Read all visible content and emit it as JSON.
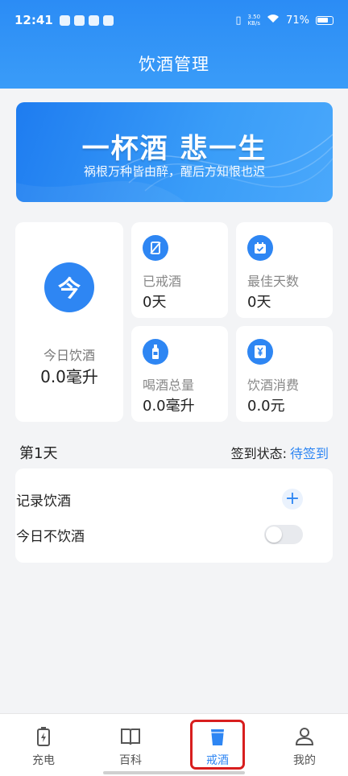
{
  "status_bar": {
    "time": "12:41",
    "net_speed_value": "3.50",
    "net_speed_unit": "KB/s",
    "battery": "71%"
  },
  "header": {
    "title": "饮酒管理"
  },
  "banner": {
    "title": "一杯酒 悲一生",
    "subtitle": "祸根万种皆由醉，醒后方知恨也迟"
  },
  "today": {
    "icon_char": "今",
    "label": "今日饮酒",
    "value": "0.0毫升"
  },
  "stats": [
    {
      "label": "已戒酒",
      "value": "0天",
      "icon": "no-drink-icon"
    },
    {
      "label": "最佳天数",
      "value": "0天",
      "icon": "calendar-check-icon"
    },
    {
      "label": "喝酒总量",
      "value": "0.0毫升",
      "icon": "bottle-icon"
    },
    {
      "label": "饮酒消费",
      "value": "0.0元",
      "icon": "yen-icon"
    }
  ],
  "day": {
    "label": "第1天",
    "checkin_label": "签到状态:",
    "checkin_state": "待签到"
  },
  "actions": {
    "record_label": "记录饮酒",
    "add_symbol": "+",
    "no_drink_label": "今日不饮酒",
    "no_drink_enabled": false
  },
  "tabbar": {
    "items": [
      {
        "label": "充电",
        "icon": "battery-charge-icon",
        "active": false
      },
      {
        "label": "百科",
        "icon": "book-icon",
        "active": false
      },
      {
        "label": "戒酒",
        "icon": "cup-icon",
        "active": true
      },
      {
        "label": "我的",
        "icon": "profile-icon",
        "active": false
      }
    ]
  },
  "colors": {
    "primary": "#2e86f3",
    "highlight": "#d81e1e",
    "background": "#f3f4f6"
  }
}
